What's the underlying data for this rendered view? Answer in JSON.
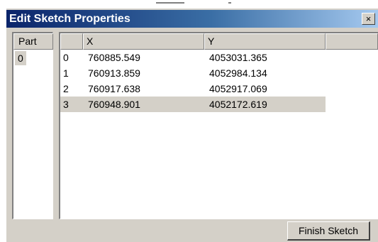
{
  "window": {
    "title": "Edit Sketch Properties",
    "close_glyph": "×",
    "close_icon": "close-icon"
  },
  "part_panel": {
    "header": "Part",
    "items": [
      "0"
    ]
  },
  "grid": {
    "columns": [
      "",
      "X",
      "Y",
      ""
    ],
    "rows": [
      {
        "index": "0",
        "x": "760885.549",
        "y": "4053031.365"
      },
      {
        "index": "1",
        "x": "760913.859",
        "y": "4052984.134"
      },
      {
        "index": "2",
        "x": "760917.638",
        "y": "4052917.069"
      },
      {
        "index": "3",
        "x": "760948.901",
        "y": "4052172.619"
      }
    ],
    "selected_row": "3"
  },
  "footer": {
    "finish_label": "Finish Sketch"
  },
  "colors": {
    "title_gradient_start": "#0a246a",
    "title_gradient_end": "#a6caf0",
    "face": "#d4d0c8"
  }
}
